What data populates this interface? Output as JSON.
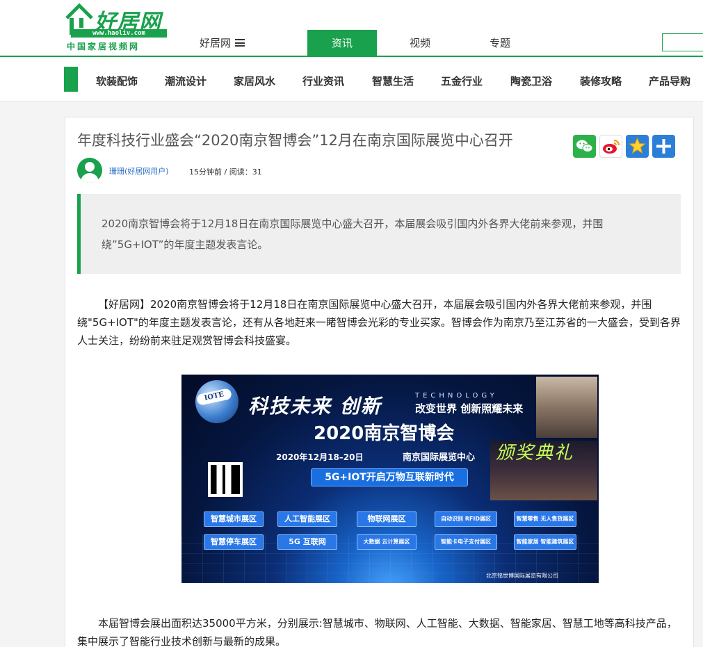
{
  "header": {
    "logo_main": "好居网",
    "logo_url": "www.haoliv.com",
    "logo_sub": "中国家居视频网",
    "site_menu_label": "好居网",
    "tabs": [
      "资讯",
      "视频",
      "专题"
    ],
    "active_tab": "资讯"
  },
  "category_nav": {
    "items": [
      "软装配饰",
      "潮流设计",
      "家居风水",
      "行业资讯",
      "智慧生活",
      "五金行业",
      "陶瓷卫浴",
      "装修攻略",
      "产品导购"
    ]
  },
  "article": {
    "title": "年度科技行业盛会“2020南京智博会”12月在南京国际展览中心召开",
    "author": "珊珊(好居网用户)",
    "meta": "15分钟前 / 阅读：31",
    "summary": "2020南京智博会将于12月18日在南京国际展览中心盛大召开，本届展会吸引国内外各界大佬前来参观，并围绕”5G+IOT”的年度主题发表言论。",
    "paragraph1": "【好居网】2020南京智博会将于12月18日在南京国际展览中心盛大召开，本届展会吸引国内外各界大佬前来参观，并围绕\"5G+IOT\"的年度主题发表言论，还有从各地赶来一睹智博会光彩的专业买家。智博会作为南京乃至江苏省的一大盛会，受到各界人士关注，纷纷前来驻足观赏智博会科技盛宴。",
    "paragraph2": "本届智博会展出面积达35000平方米，分别展示:智慧城市、物联网、人工智能、大数据、智能家居、智慧工地等高科技产品，集中展示了智能行业技术创新与最新的成果。"
  },
  "share_icons": [
    "wechat-icon",
    "weibo-icon",
    "favorite-icon",
    "more-icon"
  ],
  "banner": {
    "iote": "IOTE",
    "headline1": "科技未来   创新",
    "technology": "TECHNOLOGY",
    "slogan": "改变世界 创新照耀未来",
    "headline2": "2020南京智博会",
    "date": "2020年12月18–20日",
    "venue": "南京国际展览中心",
    "theme": "5G+IOT开启万物互联新时代",
    "award": "颁奖典礼",
    "zones_row1": [
      "智慧城市展区",
      "人工智能展区",
      "物联网展区",
      "自动识别 RFID展区",
      "智慧零售 无人售货展区"
    ],
    "zones_row2": [
      "智慧停车展区",
      "5G  互联网",
      "大数据 云计算展区",
      "智能卡电子支付展区",
      "智能家居 智能建筑展区"
    ],
    "footer": "北京铭世博国际展览有限公司"
  },
  "colors": {
    "brand_green": "#1aa14d",
    "link_blue": "#2a6fc4"
  }
}
